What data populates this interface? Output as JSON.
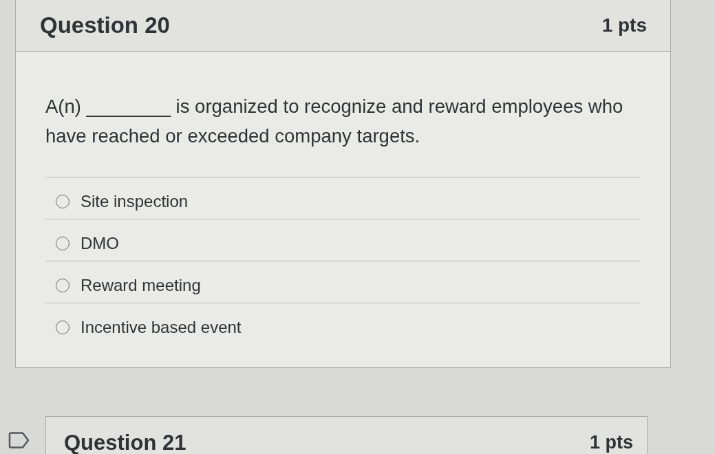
{
  "questions": [
    {
      "title": "Question 20",
      "points": "1 pts",
      "prompt": "A(n) ________ is organized to recognize and reward employees who have reached or exceeded company targets.",
      "options": [
        {
          "label": "Site inspection",
          "selected": false
        },
        {
          "label": "DMO",
          "selected": false
        },
        {
          "label": "Reward meeting",
          "selected": false
        },
        {
          "label": "Incentive based event",
          "selected": false
        }
      ]
    },
    {
      "title": "Question 21",
      "points": "1 pts",
      "flagged": false
    }
  ]
}
